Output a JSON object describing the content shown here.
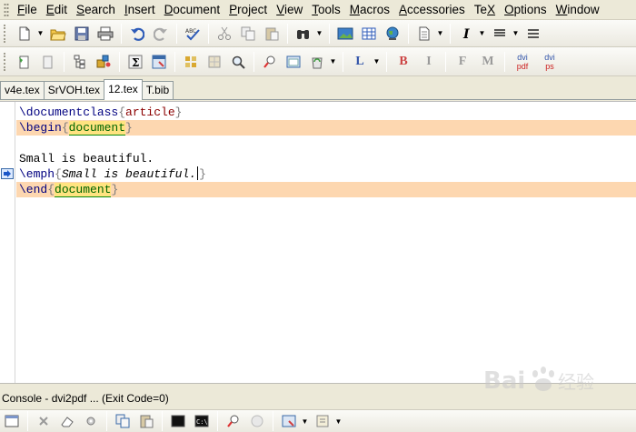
{
  "menu": {
    "items": [
      {
        "label": "File",
        "key": "F"
      },
      {
        "label": "Edit",
        "key": "E"
      },
      {
        "label": "Search",
        "key": "S"
      },
      {
        "label": "Insert",
        "key": "I"
      },
      {
        "label": "Document",
        "key": "D"
      },
      {
        "label": "Project",
        "key": "P"
      },
      {
        "label": "View",
        "key": "V"
      },
      {
        "label": "Tools",
        "key": "T"
      },
      {
        "label": "Macros",
        "key": "M"
      },
      {
        "label": "Accessories",
        "key": "A"
      },
      {
        "label": "TeX",
        "key": "X"
      },
      {
        "label": "Options",
        "key": "O"
      },
      {
        "label": "Window",
        "key": "W"
      }
    ]
  },
  "toolbar2": {
    "bold": "B",
    "italic": "I",
    "font_f": "F",
    "font_m": "M",
    "latex_l": "L",
    "dvipdf_top": "dvi",
    "dvipdf_bottom": "pdf",
    "dvips_top": "dvi",
    "dvips_bottom": "ps"
  },
  "tabs": [
    {
      "label": "v4e.tex",
      "active": false
    },
    {
      "label": "SrVOH.tex",
      "active": false
    },
    {
      "label": "12.tex",
      "active": true
    },
    {
      "label": "T.bib",
      "active": false
    }
  ],
  "editor": {
    "line1": {
      "cmd": "\\documentclass",
      "open": "{",
      "arg": "article",
      "close": "}"
    },
    "line2": {
      "cmd": "\\begin",
      "open": "{",
      "arg": "document",
      "close": "}"
    },
    "line4": {
      "text": "Small is beautiful."
    },
    "line5": {
      "cmd": "\\emph",
      "open": "{",
      "arg": "Small is beautiful.",
      "close": "}"
    },
    "line6": {
      "cmd": "\\end",
      "open": "{",
      "arg": "document",
      "close": "}"
    }
  },
  "console": {
    "title": "Console - dvi2pdf ... (Exit Code=0)"
  },
  "colors": {
    "highlight_line": "#fdd7b0",
    "env_name_bg": "#ffe380",
    "command": "#000080",
    "argument": "#8b0000"
  },
  "watermark": {
    "text": "Bai百度经验"
  }
}
